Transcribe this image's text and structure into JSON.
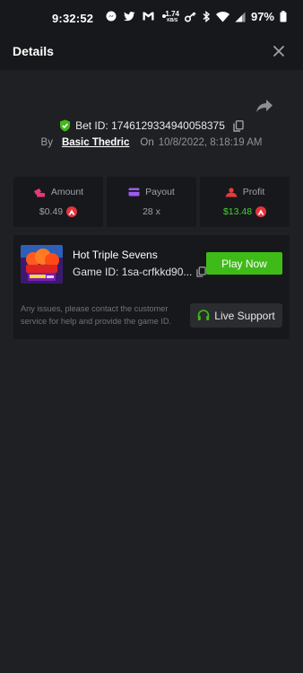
{
  "status_bar": {
    "time": "9:32:52",
    "net_speed_value": "1.74",
    "net_speed_unit": "KB/S",
    "battery": "97%",
    "icons": [
      "messenger-icon",
      "twitter-icon",
      "gmail-icon",
      "dot-icon",
      "key-icon",
      "bluetooth-icon",
      "wifi-icon",
      "signal-icon",
      "battery-icon"
    ]
  },
  "header": {
    "title": "Details",
    "close_icon": "close-icon"
  },
  "bet": {
    "id_label": "Bet ID: ",
    "id_value": "1746129334940058375",
    "by_label": "By",
    "user": "Basic Thedric",
    "on_label": "On",
    "date": "10/8/2022, 8:18:19 AM"
  },
  "stats": [
    {
      "label": "Amount",
      "value": "$0.49",
      "icon": "amount-icon",
      "color": "#e8367c"
    },
    {
      "label": "Payout",
      "value": "28 x",
      "icon": "payout-icon",
      "color": "#9b5cf0"
    },
    {
      "label": "Profit",
      "value": "$13.48",
      "icon": "profit-icon",
      "color": "#e83a3a"
    }
  ],
  "game": {
    "name": "Hot Triple Sevens",
    "id_label": "Game ID: ",
    "id_value": "1sa-crfkkd90...",
    "play_label": "Play Now",
    "issue_text": "Any issues, please contact the customer service for help and provide the game ID.",
    "support_label": "Live Support"
  },
  "colors": {
    "accent_green": "#3fbb18",
    "profit_green": "#3fd52f",
    "coin_red": "#e5333a",
    "background": "#1f2023",
    "panel": "#17181b"
  }
}
